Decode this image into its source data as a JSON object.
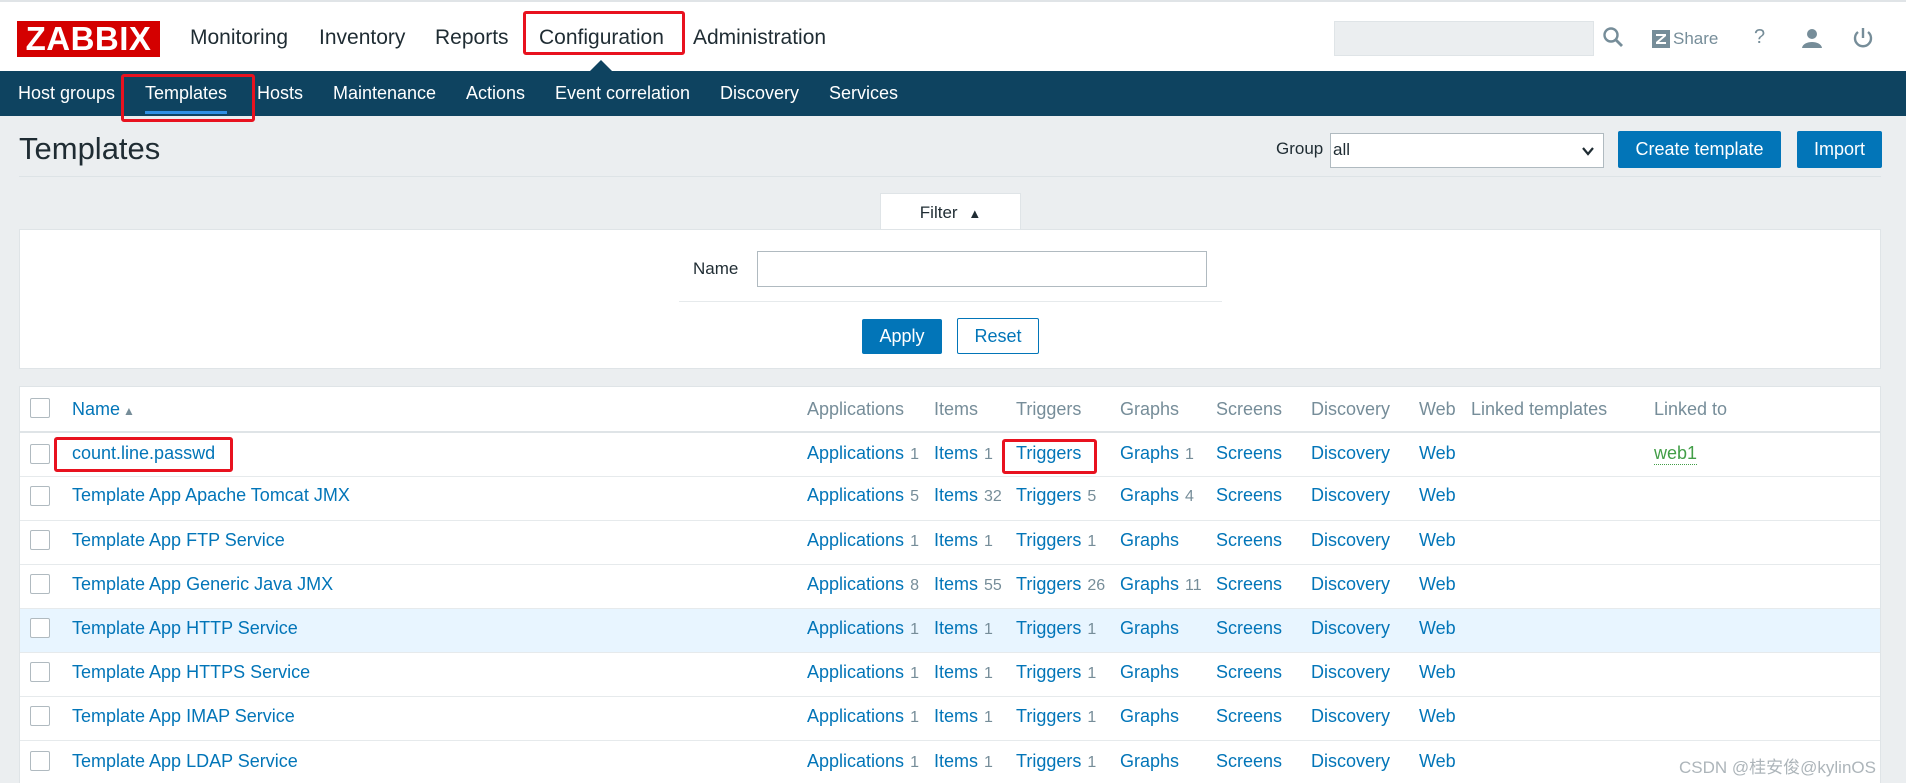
{
  "header": {
    "logo": "ZABBIX",
    "nav": [
      "Monitoring",
      "Inventory",
      "Reports",
      "Configuration",
      "Administration"
    ],
    "share": "Share",
    "help_icon": "?",
    "icons": [
      "search-icon",
      "zabbix-share-icon",
      "help-icon",
      "user-icon",
      "power-icon"
    ]
  },
  "subnav": [
    "Host groups",
    "Templates",
    "Hosts",
    "Maintenance",
    "Actions",
    "Event correlation",
    "Discovery",
    "Services"
  ],
  "page": {
    "title": "Templates",
    "group_label": "Group",
    "group_value": "all",
    "create_label": "Create template",
    "import_label": "Import"
  },
  "filter": {
    "tab_label": "Filter",
    "tab_arrow": "▲",
    "name_label": "Name",
    "name_value": "",
    "apply_label": "Apply",
    "reset_label": "Reset"
  },
  "table": {
    "columns": [
      "Name",
      "Applications",
      "Items",
      "Triggers",
      "Graphs",
      "Screens",
      "Discovery",
      "Web",
      "Linked templates",
      "Linked to"
    ],
    "sort_arrow": "▲",
    "rows": [
      {
        "name": "count.line.passwd",
        "applications": "Applications",
        "apps_count": "1",
        "items": "Items",
        "items_count": "1",
        "triggers": "Triggers",
        "triggers_count": "",
        "graphs": "Graphs",
        "graphs_count": "1",
        "screens": "Screens",
        "discovery": "Discovery",
        "web": "Web",
        "linked_to": "web1"
      },
      {
        "name": "Template App Apache Tomcat JMX",
        "applications": "Applications",
        "apps_count": "5",
        "items": "Items",
        "items_count": "32",
        "triggers": "Triggers",
        "triggers_count": "5",
        "graphs": "Graphs",
        "graphs_count": "4",
        "screens": "Screens",
        "discovery": "Discovery",
        "web": "Web",
        "linked_to": ""
      },
      {
        "name": "Template App FTP Service",
        "applications": "Applications",
        "apps_count": "1",
        "items": "Items",
        "items_count": "1",
        "triggers": "Triggers",
        "triggers_count": "1",
        "graphs": "Graphs",
        "graphs_count": "",
        "screens": "Screens",
        "discovery": "Discovery",
        "web": "Web",
        "linked_to": ""
      },
      {
        "name": "Template App Generic Java JMX",
        "applications": "Applications",
        "apps_count": "8",
        "items": "Items",
        "items_count": "55",
        "triggers": "Triggers",
        "triggers_count": "26",
        "graphs": "Graphs",
        "graphs_count": "11",
        "screens": "Screens",
        "discovery": "Discovery",
        "web": "Web",
        "linked_to": ""
      },
      {
        "name": "Template App HTTP Service",
        "applications": "Applications",
        "apps_count": "1",
        "items": "Items",
        "items_count": "1",
        "triggers": "Triggers",
        "triggers_count": "1",
        "graphs": "Graphs",
        "graphs_count": "",
        "screens": "Screens",
        "discovery": "Discovery",
        "web": "Web",
        "linked_to": ""
      },
      {
        "name": "Template App HTTPS Service",
        "applications": "Applications",
        "apps_count": "1",
        "items": "Items",
        "items_count": "1",
        "triggers": "Triggers",
        "triggers_count": "1",
        "graphs": "Graphs",
        "graphs_count": "",
        "screens": "Screens",
        "discovery": "Discovery",
        "web": "Web",
        "linked_to": ""
      },
      {
        "name": "Template App IMAP Service",
        "applications": "Applications",
        "apps_count": "1",
        "items": "Items",
        "items_count": "1",
        "triggers": "Triggers",
        "triggers_count": "1",
        "graphs": "Graphs",
        "graphs_count": "",
        "screens": "Screens",
        "discovery": "Discovery",
        "web": "Web",
        "linked_to": ""
      },
      {
        "name": "Template App LDAP Service",
        "applications": "Applications",
        "apps_count": "1",
        "items": "Items",
        "items_count": "1",
        "triggers": "Triggers",
        "triggers_count": "1",
        "graphs": "Graphs",
        "graphs_count": "",
        "screens": "Screens",
        "discovery": "Discovery",
        "web": "Web",
        "linked_to": ""
      }
    ]
  },
  "watermark": "CSDN @桂安俊@kylinOS",
  "colors": {
    "accent": "#0275b8",
    "nav_bg": "#0e4360",
    "logo": "#d40000",
    "highlight": "#e8121f",
    "link_green": "#429e47"
  }
}
